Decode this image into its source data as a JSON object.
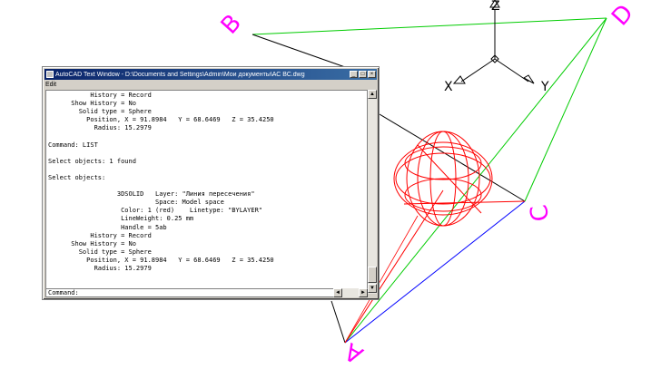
{
  "vertex_labels": {
    "a": "A",
    "b": "B",
    "c": "C",
    "d": "D"
  },
  "axis_labels": {
    "x": "X",
    "y": "Y",
    "z": "Z"
  },
  "colors": {
    "vertex_label": "#ff00ff",
    "sphere": "#ff0000",
    "edge_green": "#00cc00",
    "edge_blue": "#0000ff",
    "edge_red": "#ff0000",
    "edge_black": "#000000",
    "titlebar": "#0a246a"
  },
  "text_window": {
    "title": "AutoCAD Text Window - D:\\Documents and Settings\\Admin\\Мои документы\\АС ВС.dwg",
    "menu_edit": "Edit",
    "buttons": {
      "minimize": "_",
      "maximize": "□",
      "close": "×"
    },
    "lines": [
      "           History = Record",
      "      Show History = No",
      "        Solid type = Sphere",
      "          Position, X = 91.8984   Y = 68.6469   Z = 35.4250",
      "            Radius: 15.2979",
      "",
      "Command: LIST",
      "",
      "Select objects: 1 found",
      "",
      "Select objects:",
      "",
      "                  3DSOLID   Layer: \"Линия пересечения\"",
      "                            Space: Model space",
      "                   Color: 1 (red)    Linetype: \"BYLAYER\"",
      "                   LineWeight: 0.25 mm",
      "                   Handle = 5ab",
      "           History = Record",
      "      Show History = No",
      "        Solid type = Sphere",
      "          Position, X = 91.8984   Y = 68.6469   Z = 35.4250",
      "            Radius: 15.2979"
    ],
    "command_prompt": "Command:"
  }
}
